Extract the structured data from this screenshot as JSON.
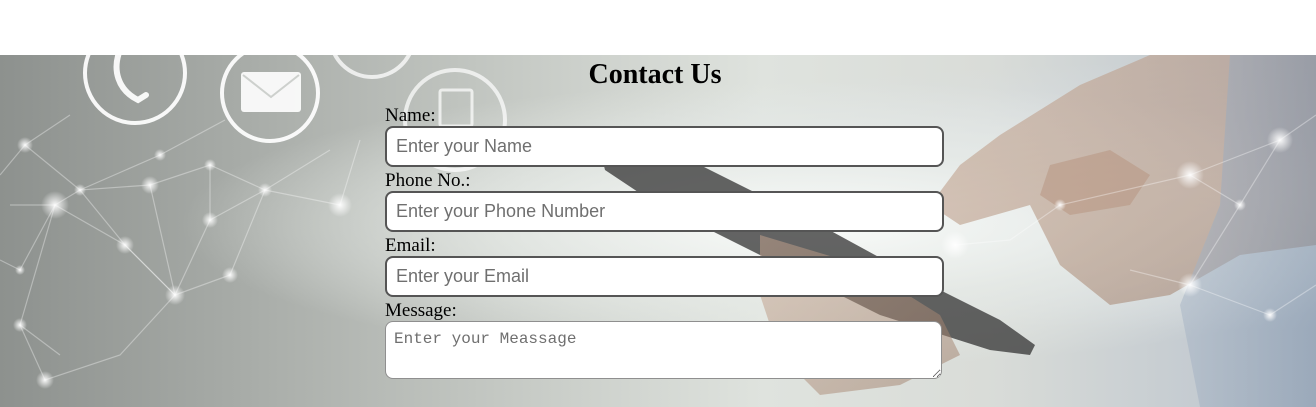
{
  "page": {
    "title": "Contact Us"
  },
  "form": {
    "name": {
      "label": "Name:",
      "placeholder": "Enter your Name",
      "value": ""
    },
    "phone": {
      "label": "Phone No.:",
      "placeholder": "Enter your Phone Number",
      "value": ""
    },
    "email": {
      "label": "Email:",
      "placeholder": "Enter your Email",
      "value": ""
    },
    "message": {
      "label": "Message:",
      "placeholder": "Enter your Meassage",
      "value": ""
    }
  },
  "background": {
    "image": "hand holding smartphone with network nodes",
    "icons": [
      "phone-icon",
      "mail-icon",
      "mobile-device-icon"
    ]
  }
}
